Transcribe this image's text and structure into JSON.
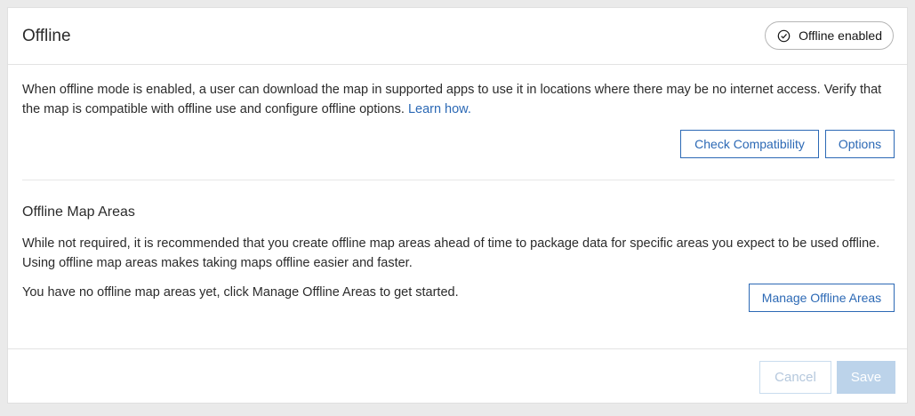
{
  "header": {
    "title": "Offline",
    "status_label": "Offline enabled",
    "status_icon": "check-circle-icon"
  },
  "intro": {
    "text": "When offline mode is enabled, a user can download the map in supported apps to use it in locations where there may be no internet access. Verify that the map is compatible with offline use and configure offline options.",
    "link_label": "Learn how."
  },
  "actions": {
    "check_label": "Check Compatibility",
    "options_label": "Options"
  },
  "map_areas": {
    "title": "Offline Map Areas",
    "description": "While not required, it is recommended that you create offline map areas ahead of time to package data for specific areas you expect to be used offline. Using offline map areas makes taking maps offline easier and faster.",
    "empty_message": "You have no offline map areas yet, click Manage Offline Areas to get started.",
    "manage_label": "Manage Offline Areas"
  },
  "footer": {
    "cancel_label": "Cancel",
    "save_label": "Save"
  },
  "colors": {
    "accent": "#2c69b5",
    "disabled_bg": "#bcd3ea"
  }
}
